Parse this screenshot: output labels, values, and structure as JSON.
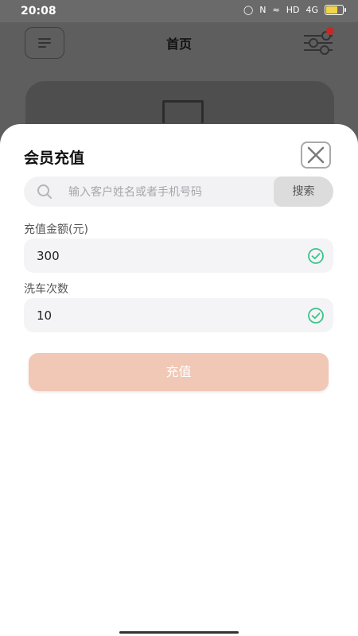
{
  "status": {
    "time": "20:08",
    "network": "4G",
    "hd": "HD"
  },
  "header": {
    "title": "首页"
  },
  "sheet": {
    "title": "会员充值",
    "search": {
      "placeholder": "输入客户姓名或者手机号码",
      "button_label": "搜索"
    },
    "fields": [
      {
        "label": "充值金额(元)",
        "value": "300"
      },
      {
        "label": "洗车次数",
        "value": "10"
      }
    ],
    "submit_label": "充值"
  },
  "colors": {
    "accent_disabled": "#f1c7b6",
    "check_green": "#3cc38a",
    "badge_red": "#c62828"
  }
}
